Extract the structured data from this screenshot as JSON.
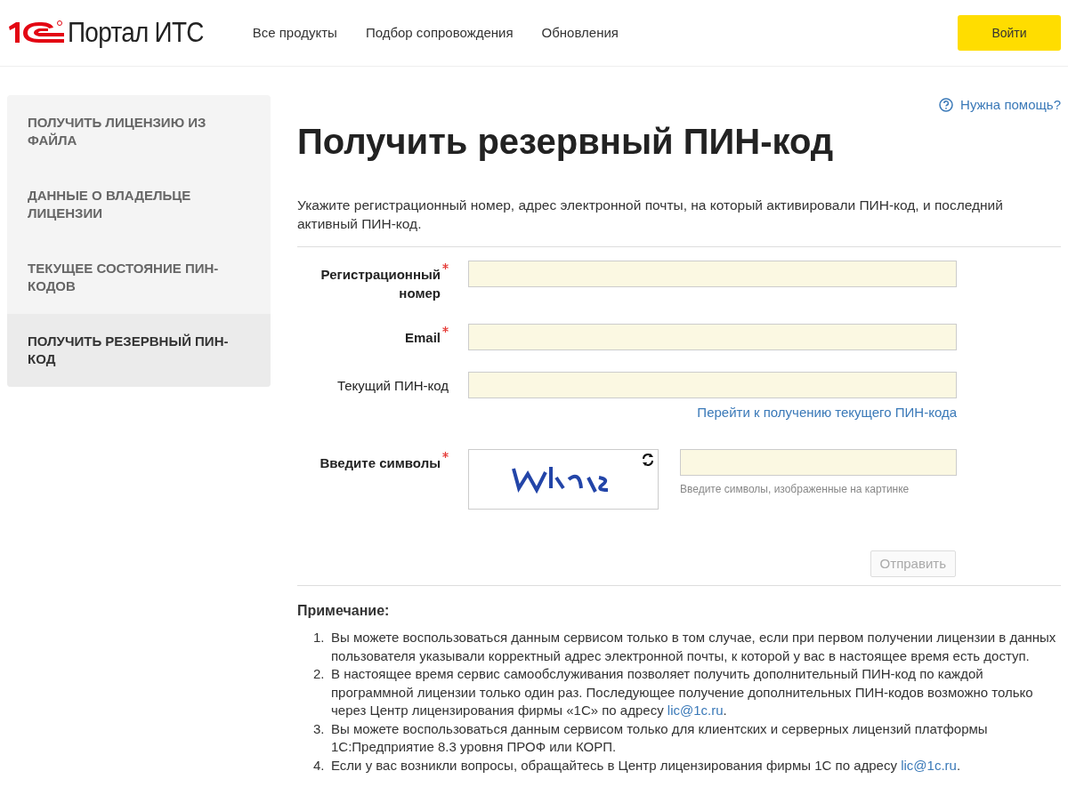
{
  "header": {
    "brand": "Портал ИТС",
    "nav": [
      "Все продукты",
      "Подбор сопровождения",
      "Обновления"
    ],
    "login_button": "Войти"
  },
  "sidebar": {
    "items": [
      {
        "label": "ПОЛУЧИТЬ ЛИЦЕНЗИЮ ИЗ ФАЙЛА",
        "selected": false
      },
      {
        "label": "ДАННЫЕ О ВЛАДЕЛЬЦЕ ЛИЦЕНЗИИ",
        "selected": false
      },
      {
        "label": "ТЕКУЩЕЕ СОСТОЯНИЕ ПИН-КОДОВ",
        "selected": false
      },
      {
        "label": "ПОЛУЧИТЬ РЕЗЕРВНЫЙ ПИН-КОД",
        "selected": true
      }
    ]
  },
  "help_link": "Нужна помощь?",
  "title": "Получить резервный ПИН-код",
  "description": "Укажите регистрационный номер, адрес электронной почты, на который активировали ПИН-код, и последний активный ПИН-код.",
  "form": {
    "fields": [
      {
        "label": "Регистрационный номер",
        "required": true
      },
      {
        "label": "Email",
        "required": true
      },
      {
        "label": "Текущий ПИН-код",
        "required": false,
        "link": "Перейти к получению текущего ПИН-кода"
      }
    ],
    "captcha": {
      "label": "Введите символы",
      "required": true,
      "hint": "Введите символы, изображенные на картинке"
    },
    "submit": {
      "label": "Отправить",
      "disabled": true
    }
  },
  "notes": {
    "title": "Примечание:",
    "items": [
      {
        "number": "1.",
        "text": "Вы можете воспользоваться данным сервисом только в том случае, если при первом получении лицензии в данных пользователя указывали корректный адрес электронной почты, к которой у вас в настоящее время есть доступ."
      },
      {
        "number": "2.",
        "text": "В настоящее время сервис самообслуживания позволяет получить дополнительный ПИН-код по каждой программной лицензии только один раз. Последующее получение дополнительных ПИН-кодов возможно только через Центр лицензирования фирмы «1С» по адресу ",
        "link": "lic@1c.ru",
        "tail": "."
      },
      {
        "number": "3.",
        "text": "Вы можете воспользоваться данным сервисом только для клиентских и серверных лицензий платформы 1С:Предприятие 8.3 уровня ПРОФ или КОРП."
      },
      {
        "number": "4.",
        "text": "Если у вас возникли вопросы, обращайтесь в Центр лицензирования фирмы 1С по адресу ",
        "link": "lic@1c.ru",
        "tail": "."
      }
    ]
  }
}
